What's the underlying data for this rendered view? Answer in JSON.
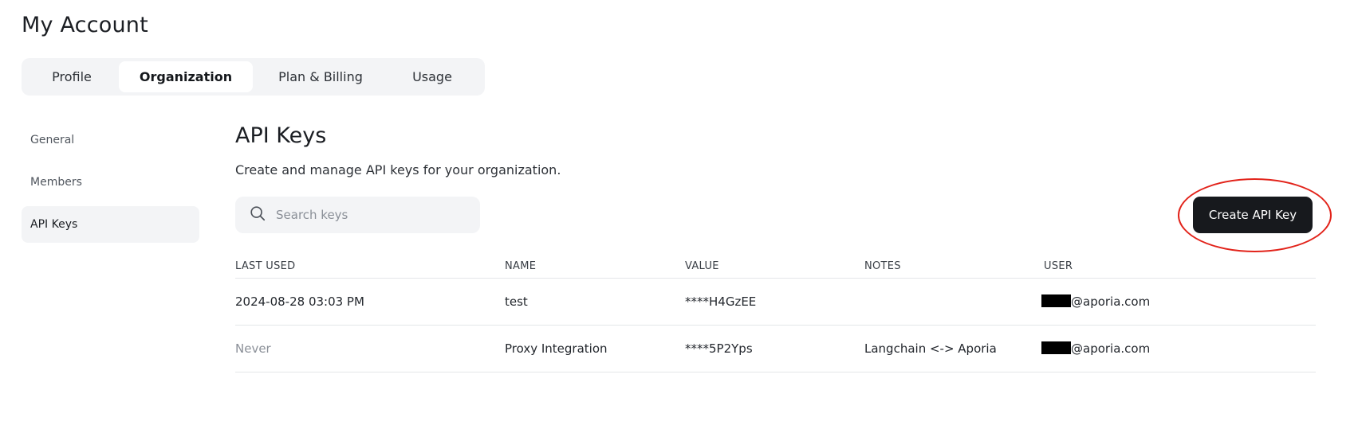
{
  "page": {
    "title": "My Account"
  },
  "tabs": [
    {
      "label": "Profile",
      "active": false
    },
    {
      "label": "Organization",
      "active": true
    },
    {
      "label": "Plan & Billing",
      "active": false
    },
    {
      "label": "Usage",
      "active": false
    }
  ],
  "sidebar": {
    "items": [
      {
        "label": "General",
        "active": false
      },
      {
        "label": "Members",
        "active": false
      },
      {
        "label": "API Keys",
        "active": true
      }
    ]
  },
  "section": {
    "title": "API Keys",
    "description": "Create and manage API keys for your organization."
  },
  "search": {
    "placeholder": "Search keys",
    "value": "",
    "icon": "search-icon"
  },
  "create_button": {
    "label": "Create API Key",
    "highlighted": true,
    "highlight_color": "#e2231a"
  },
  "table": {
    "headers": [
      "LAST USED",
      "NAME",
      "VALUE",
      "NOTES",
      "USER"
    ],
    "rows": [
      {
        "last_used": "2024-08-28 03:03 PM",
        "name": "test",
        "value": "****H4GzEE",
        "notes": "",
        "user_domain": "@aporia.com"
      },
      {
        "last_used": "Never",
        "name": "Proxy Integration",
        "value": "****5P2Yps",
        "notes": "Langchain <-> Aporia",
        "user_domain": "@aporia.com"
      }
    ]
  }
}
